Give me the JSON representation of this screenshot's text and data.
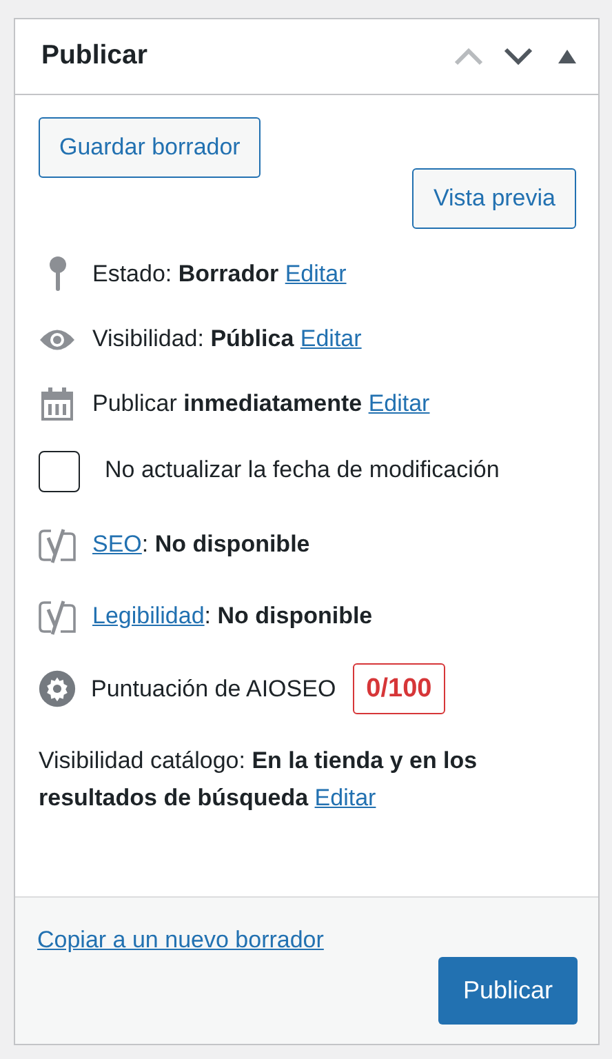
{
  "panel": {
    "title": "Publicar",
    "move_up": {
      "disabled": true
    },
    "move_down": {
      "disabled": false
    },
    "expanded": true
  },
  "buttons": {
    "save_draft": "Guardar borrador",
    "preview": "Vista previa"
  },
  "rows": [
    {
      "kind": "status",
      "before": "Estado: **Borrador**",
      "link": "Editar"
    },
    {
      "kind": "visibility",
      "before": "Visibilidad: **Pública**",
      "link": "Editar"
    },
    {
      "kind": "schedule",
      "before": "Publicar **inmediatamente**",
      "link": "Editar"
    },
    {
      "kind": "checkbox",
      "label": "No actualizar la fecha de modificación",
      "checked": false
    },
    {
      "kind": "yoast",
      "link": "SEO",
      "after": ": **No disponible**"
    },
    {
      "kind": "yoast",
      "link": "Legibilidad",
      "after": ": **No disponible**"
    },
    {
      "kind": "aioseo",
      "label": "Puntuación de AIOSEO",
      "score": "0/100"
    },
    {
      "kind": "catalog",
      "before": "Visibilidad catálogo: **En la tienda y en los resultados de búsqueda**",
      "link": "Editar"
    }
  ],
  "footer": {
    "copy_link": "Copiar a un nuevo borrador",
    "publish": "Publicar"
  }
}
